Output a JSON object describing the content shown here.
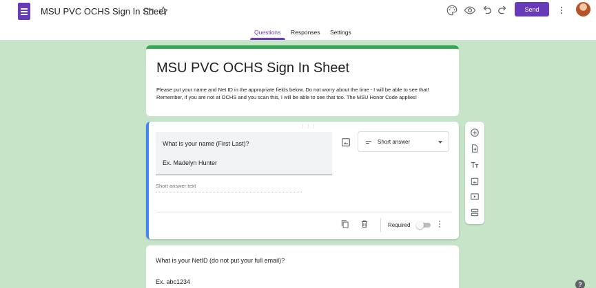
{
  "header": {
    "doc_title": "MSU PVC OCHS Sign In Sheet",
    "send_label": "Send"
  },
  "tabs": [
    {
      "label": "Questions",
      "active": true
    },
    {
      "label": "Responses",
      "active": false
    },
    {
      "label": "Settings",
      "active": false
    }
  ],
  "form": {
    "title": "MSU PVC OCHS Sign In Sheet",
    "description": "Please put your name and Net ID in the appropriate fields below. Do not worry about the time - I will be able to see that! Remember, if you are not at OCHS and you scan this, I will be able to see that too. The MSU Honor Code applies!"
  },
  "questions": [
    {
      "text": "What is your name (First Last)?",
      "hint": "Ex. Madelyn Hunter",
      "type": "Short answer",
      "answer_placeholder": "Short answer text",
      "required_label": "Required",
      "required": false
    },
    {
      "text": "What is your NetID (do not put your full email)?",
      "hint": "Ex. abc1234"
    }
  ],
  "help_label": "?",
  "colors": {
    "accent": "#673ab7",
    "background": "#c6e4c7",
    "title_card_stripe": "#34a853",
    "active_question_border": "#4285f4"
  },
  "icons": [
    "forms-logo-icon",
    "folder-icon",
    "star-icon",
    "palette-icon",
    "preview-eye-icon",
    "undo-icon",
    "redo-icon",
    "more-vert-icon",
    "image-icon",
    "short-answer-lines-icon",
    "copy-icon",
    "trash-icon",
    "add-question-icon",
    "import-questions-icon",
    "title-text-icon",
    "add-image-icon",
    "add-video-icon",
    "add-section-icon",
    "help-icon"
  ]
}
